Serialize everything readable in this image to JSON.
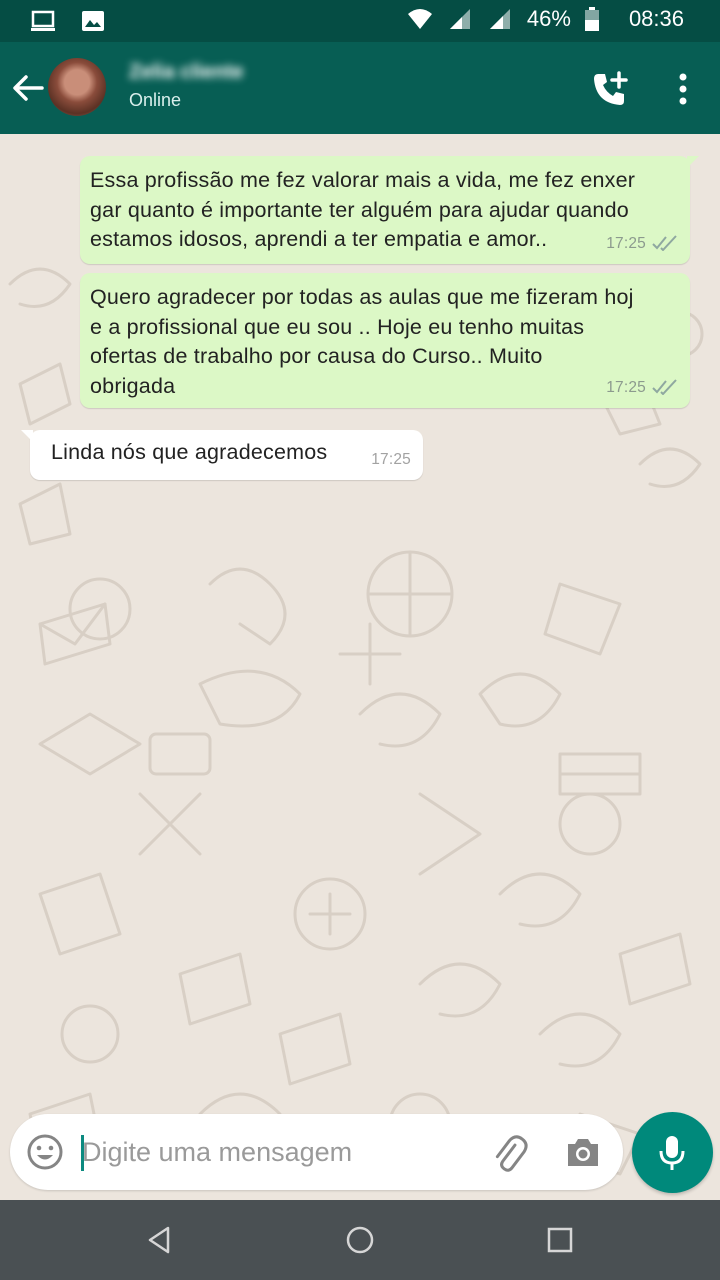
{
  "status_bar": {
    "battery": "46%",
    "time": "08:36"
  },
  "header": {
    "contact_name": "Zelia cliente",
    "contact_status": "Online"
  },
  "messages": [
    {
      "direction": "outgoing",
      "text": "Essa profissão me fez valorar mais a vida, me fez enxer\ngar quanto é importante ter alguém para ajudar quando\nestamos idosos, aprendi a ter empatia e amor..",
      "time": "17:25"
    },
    {
      "direction": "outgoing",
      "text": "Quero agradecer por todas as aulas que me fizeram hoj\ne a profissional que eu sou .. Hoje eu tenho muitas\nofertas de trabalho por causa do Curso.. Muito\nobrigada",
      "time": "17:25"
    },
    {
      "direction": "incoming",
      "text": "Linda nós que agradecemos",
      "time": "17:25"
    }
  ],
  "composer": {
    "placeholder": "Digite uma mensagem",
    "value": ""
  },
  "icons": {
    "status_bar": [
      "screen-cast-icon",
      "image-icon",
      "wifi-icon",
      "signal-icon",
      "signal-icon",
      "battery-icon"
    ],
    "header": [
      "back-arrow-icon",
      "add-call-icon",
      "more-vert-icon"
    ],
    "composer": [
      "emoji-icon",
      "attach-icon",
      "camera-icon",
      "mic-icon"
    ],
    "navigation": [
      "back-triangle-icon",
      "home-circle-icon",
      "recents-square-icon"
    ]
  },
  "colors": {
    "status_bar": "#054D44",
    "header": "#075E54",
    "outgoing_bubble": "#DCF8C6",
    "incoming_bubble": "#FFFFFF",
    "chat_background": "#ECE5DD",
    "mic_button": "#00897B",
    "nav_bar": "#4A5053"
  }
}
